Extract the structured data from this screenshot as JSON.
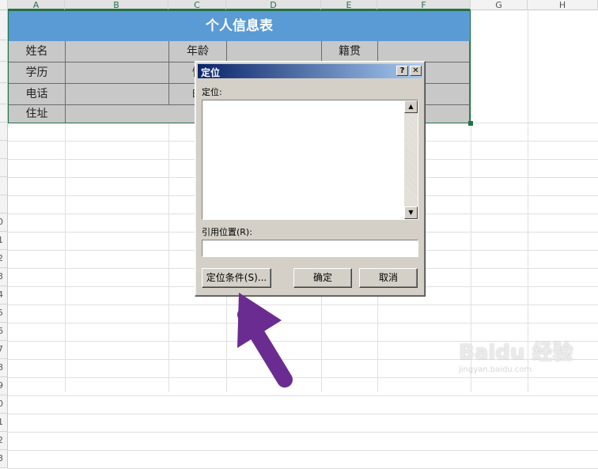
{
  "columns": [
    "A",
    "B",
    "C",
    "D",
    "E",
    "F",
    "G",
    "H"
  ],
  "rows": [
    "",
    "",
    "",
    "",
    "",
    "",
    "",
    "",
    "",
    "",
    "0",
    "1",
    "2",
    "3",
    "4",
    "5",
    "6",
    "7",
    "8",
    "9",
    "0",
    "1",
    "2",
    "3"
  ],
  "form": {
    "title": "个人信息表",
    "labels": {
      "r1a": "姓名",
      "r1c": "年龄",
      "r1e": "籍贯",
      "r2a": "学历",
      "r2c": "性",
      "r3a": "电话",
      "r3c": "邮",
      "r4a": "住址"
    },
    "colors": {
      "title_bg": "#5b9bd5",
      "cell_bg": "#c8c8c8",
      "selection": "#217346"
    }
  },
  "dialog": {
    "title": "定位",
    "help_btn": "?",
    "close_btn": "✕",
    "goto_label": "定位:",
    "ref_label": "引用位置(R):",
    "ref_value": "",
    "special_btn": "定位条件(S)...",
    "ok_btn": "确定",
    "cancel_btn": "取消",
    "scroll_up": "▲",
    "scroll_down": "▼"
  },
  "annotation": {
    "arrow_color": "#6a2c91"
  },
  "watermark": {
    "brand": "Baidu 经验",
    "url": "jingyan.baidu.com"
  }
}
